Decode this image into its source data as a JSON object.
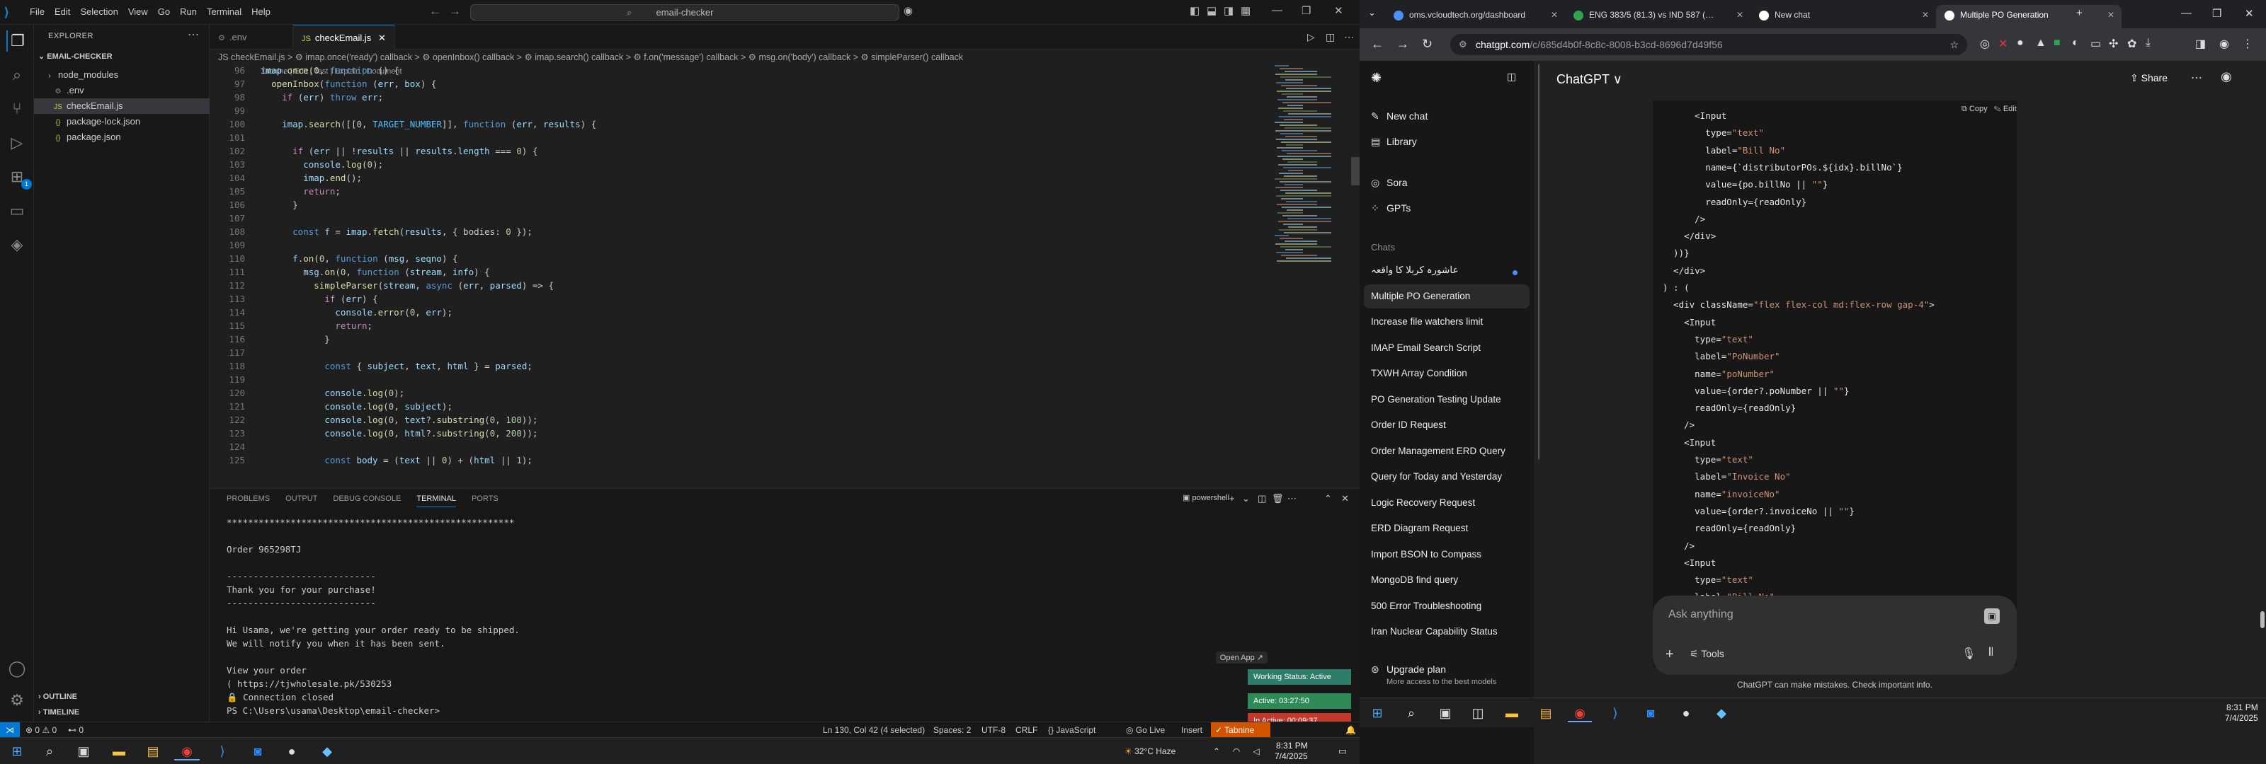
{
  "vscode": {
    "menu": [
      "File",
      "Edit",
      "Selection",
      "View",
      "Go",
      "Run",
      "Terminal",
      "Help"
    ],
    "command_center": "email-checker",
    "explorer_title": "EXPLORER",
    "folder": "EMAIL-CHECKER",
    "files": [
      {
        "name": "node_modules",
        "type": "folder"
      },
      {
        "name": ".env",
        "type": "env"
      },
      {
        "name": "checkEmail.js",
        "type": "js",
        "selected": true
      },
      {
        "name": "package-lock.json",
        "type": "json"
      },
      {
        "name": "package.json",
        "type": "json"
      }
    ],
    "outline": "OUTLINE",
    "timeline": "TIMELINE",
    "tabs": [
      {
        "label": ".env",
        "active": false
      },
      {
        "label": "checkEmail.js",
        "active": true
      }
    ],
    "breadcrumb": "JS checkEmail.js > ⚙ imap.once('ready') callback > ⚙ openInbox() callback > ⚙ imap.search() callback > ⚙ f.on('message') callback > ⚙ msg.on('body') callback > ⚙ simpleParser() callback",
    "codelens": "Tabnine | Edit | Test | Explain | Document",
    "code_lines": [
      {
        "n": "96",
        "t": "imap.once('ready', function () {"
      },
      {
        "n": "97",
        "t": "  openInbox(function (err, box) {"
      },
      {
        "n": "98",
        "t": "    if (err) throw err;"
      },
      {
        "n": "99",
        "t": ""
      },
      {
        "n": "100",
        "t": "    imap.search([['BODY', TARGET_NUMBER]], function (err, results) {"
      },
      {
        "n": "101",
        "t": ""
      },
      {
        "n": "102",
        "t": "      if (err || !results || results.length === 0) {"
      },
      {
        "n": "103",
        "t": "        console.log('No emails found');"
      },
      {
        "n": "104",
        "t": "        imap.end();"
      },
      {
        "n": "105",
        "t": "        return;"
      },
      {
        "n": "106",
        "t": "      }"
      },
      {
        "n": "107",
        "t": ""
      },
      {
        "n": "108",
        "t": "      const f = imap.fetch(results, { bodies: '' });"
      },
      {
        "n": "109",
        "t": ""
      },
      {
        "n": "110",
        "t": "      f.on('message', function (msg, seqno) {"
      },
      {
        "n": "111",
        "t": "        msg.on('body', function (stream, info) {"
      },
      {
        "n": "112",
        "t": "          simpleParser(stream, async (err, parsed) => {"
      },
      {
        "n": "113",
        "t": "            if (err) {"
      },
      {
        "n": "114",
        "t": "              console.error('Parse error:', err);"
      },
      {
        "n": "115",
        "t": "              return;"
      },
      {
        "n": "116",
        "t": "            }"
      },
      {
        "n": "117",
        "t": ""
      },
      {
        "n": "118",
        "t": "            const { subject, text, html } = parsed;"
      },
      {
        "n": "119",
        "t": ""
      },
      {
        "n": "120",
        "t": "            console.log('------------------------------');"
      },
      {
        "n": "121",
        "t": "            console.log('📧 Subject:', subject);"
      },
      {
        "n": "122",
        "t": "            console.log('📄 Text (first 100):', text?.substring(0, 100));"
      },
      {
        "n": "123",
        "t": "            console.log('🖼 HTML (first 200):', html?.substring(0, 200));"
      },
      {
        "n": "124",
        "t": ""
      },
      {
        "n": "125",
        "t": "            const body = (text || \"\") + (html || \"\");"
      }
    ],
    "panel_tabs": [
      "PROBLEMS",
      "OUTPUT",
      "DEBUG CONSOLE",
      "TERMINAL",
      "PORTS"
    ],
    "panel_shell": "powershell",
    "terminal_lines": [
      "******************************************************",
      "",
      "Order 965298TJ",
      "",
      "----------------------------",
      "Thank you for your purchase!",
      "----------------------------",
      "",
      "Hi Usama, we're getting your order ready to be shipped.",
      "We will notify you when it has been sent.",
      "",
      "View your order",
      "( https://tjwholesale.pk/530253",
      "🔒 Connection closed",
      "PS C:\\Users\\usama\\Desktop\\email-checker> "
    ],
    "open_app": "Open App ↗",
    "working_status": [
      {
        "text": "Working Status: Active",
        "color": "#2e7d6b"
      },
      {
        "text": "Active: 03:27:50",
        "color": "#2e8b57"
      },
      {
        "text": "In Active: 00:09:37",
        "color": "#c0392b"
      }
    ],
    "status": {
      "errors": "⊗ 0 ⚠ 0",
      "ports": "⊷ 0",
      "position": "Ln 130, Col 42 (4 selected)",
      "spaces": "Spaces: 2",
      "encoding": "UTF-8",
      "eol": "CRLF",
      "lang": "{} JavaScript",
      "golive": "◎ Go Live",
      "insert": "Insert",
      "tabnine": "✓ Tabnine"
    },
    "weather": "32°C  Haze",
    "time": "8:31 PM",
    "date": "7/4/2025"
  },
  "chrome": {
    "tabs": [
      {
        "label": "oms.vcloudtech.org/dashboard",
        "color": "#4c8ffc",
        "active": false
      },
      {
        "label": "ENG 383/5 (81.3) vs IND 587 (…",
        "color": "#2ea44f",
        "active": false
      },
      {
        "label": "New chat",
        "color": "#ffffff",
        "active": false
      },
      {
        "label": "Multiple PO Generation",
        "color": "#ffffff",
        "active": true
      }
    ],
    "url_domain": "chatgpt.com",
    "url_path": "/c/685d4b0f-8c8c-8008-b3cd-8696d7d49f56",
    "sidebar": {
      "new_chat": "New chat",
      "library": "Library",
      "sora": "Sora",
      "gpts": "GPTs",
      "chats_label": "Chats",
      "chats": [
        "عاشورہ کربلا کا واقعہ",
        "Multiple PO Generation",
        "Increase file watchers limit",
        "IMAP Email Search Script",
        "TXWH Array Condition",
        "PO Generation Testing Update",
        "Order ID Request",
        "Order Management ERD Query",
        "Query for Today and Yesterday",
        "Logic Recovery Request",
        "ERD Diagram Request",
        "Import BSON to Compass",
        "MongoDB find query",
        "500 Error Troubleshooting",
        "Iran Nuclear Capability Status"
      ],
      "upgrade_title": "Upgrade plan",
      "upgrade_sub": "More access to the best models"
    },
    "model": "ChatGPT ∨",
    "share": "Share",
    "copy": "⧉ Copy",
    "edit": "✎ Edit",
    "code": [
      "      <Input",
      "        type=\"text\"",
      "        label=\"Bill No\"",
      "        name={`distributorPOs.${idx}.billNo`}",
      "        value={po.billNo || \"\"}",
      "        readOnly={readOnly}",
      "      />",
      "    </div>",
      "  ))}",
      "  </div>",
      ") : (",
      "  <div className=\"flex flex-col md:flex-row gap-4\">",
      "    <Input",
      "      type=\"text\"",
      "      label=\"PoNumber\"",
      "      name=\"poNumber\"",
      "      value={order?.poNumber || \"\"}",
      "      readOnly={readOnly}",
      "    />",
      "    <Input",
      "      type=\"text\"",
      "      label=\"Invoice No\"",
      "      name=\"invoiceNo\"",
      "      value={order?.invoiceNo || \"\"}",
      "      readOnly={readOnly}",
      "    />",
      "    <Input",
      "      type=\"text\"",
      "      label=\"Bill No\""
    ],
    "ask_placeholder": "Ask anything",
    "tools": "Tools",
    "disclaimer": "ChatGPT can make mistakes. Check important info.",
    "time": "8:31 PM",
    "date": "7/4/2025"
  }
}
